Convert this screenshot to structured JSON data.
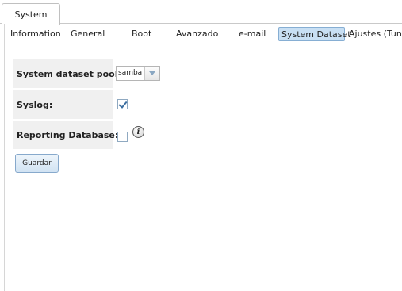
{
  "outer_tab": {
    "label": "System"
  },
  "subtabs": [
    {
      "label": "Information"
    },
    {
      "label": "General"
    },
    {
      "label": "Boot"
    },
    {
      "label": "Avanzado"
    },
    {
      "label": "e-mail"
    },
    {
      "label": "System Dataset",
      "active": true
    },
    {
      "label": "Ajustes (Tuna"
    }
  ],
  "form": {
    "pool_label": "System dataset pool:",
    "pool_value": "samba",
    "syslog_label": "Syslog:",
    "syslog_checked": true,
    "reporting_label": "Reporting Database:",
    "reporting_checked": false,
    "info_glyph": "i",
    "save_label": "Guardar"
  },
  "icons": {
    "info": "info-icon",
    "dropdown": "chevron-down-icon",
    "check": "checkmark-icon"
  }
}
